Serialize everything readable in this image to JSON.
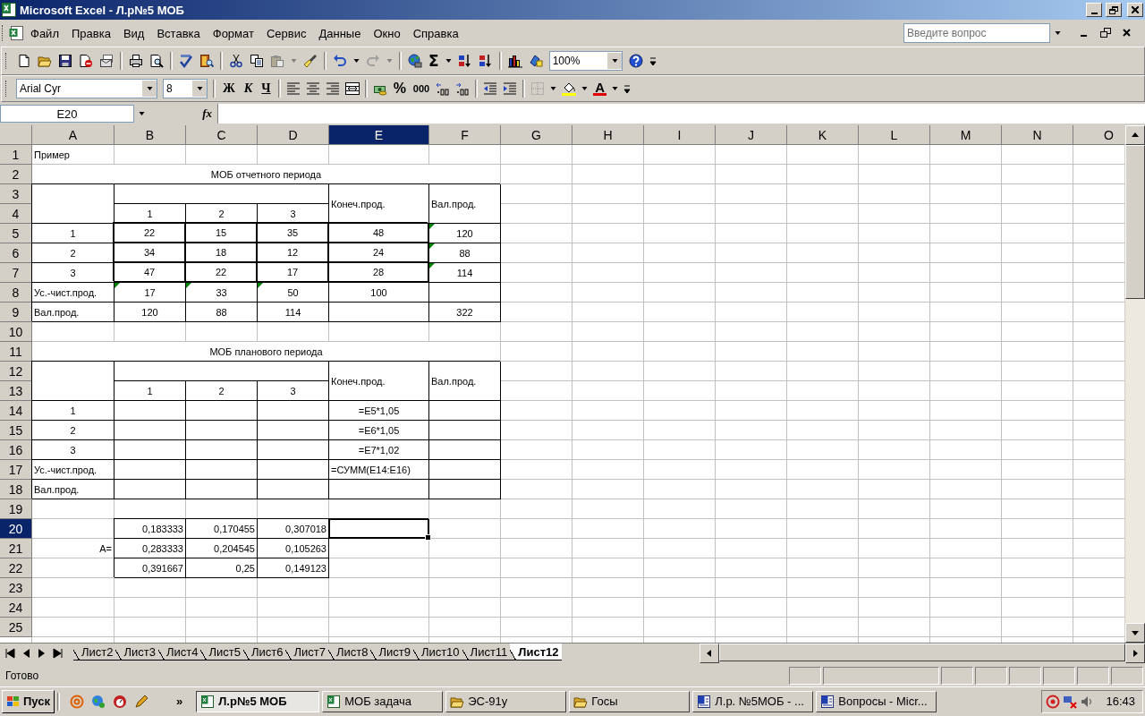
{
  "window": {
    "title": "Microsoft Excel - Л.р№5 МОБ"
  },
  "menu": [
    "Файл",
    "Правка",
    "Вид",
    "Вставка",
    "Формат",
    "Сервис",
    "Данные",
    "Окно",
    "Справка"
  ],
  "question_box": {
    "placeholder": "Введите вопрос"
  },
  "standard_toolbar": {
    "sum": "Σ",
    "zoom": "100%"
  },
  "formatting_toolbar": {
    "font": "Arial Cyr",
    "size": "8",
    "bold": "Ж",
    "italic": "К",
    "underline": "Ч",
    "percent": "%",
    "thousands": "000",
    "font_color": "A"
  },
  "formula_bar": {
    "name_box": "E20",
    "fx": "fx"
  },
  "columns": [
    {
      "label": "A",
      "selected": false
    },
    {
      "label": "B",
      "selected": false
    },
    {
      "label": "C",
      "selected": false
    },
    {
      "label": "D",
      "selected": false
    },
    {
      "label": "E",
      "selected": true
    },
    {
      "label": "F",
      "selected": false
    },
    {
      "label": "G",
      "selected": false
    },
    {
      "label": "H",
      "selected": false
    },
    {
      "label": "I",
      "selected": false
    },
    {
      "label": "J",
      "selected": false
    },
    {
      "label": "K",
      "selected": false
    },
    {
      "label": "L",
      "selected": false
    },
    {
      "label": "M",
      "selected": false
    },
    {
      "label": "N",
      "selected": false
    },
    {
      "label": "O",
      "selected": false
    }
  ],
  "rows": [
    {
      "label": "1",
      "selected": false,
      "cells": [
        {
          "text": "Пример",
          "kind": "note",
          "flag": false,
          "selected": false
        }
      ]
    },
    {
      "label": "2",
      "selected": false,
      "cells": [
        {
          "text": "МОБ отчетного периода",
          "kind": "title",
          "flag": false,
          "selected": false
        }
      ]
    },
    {
      "label": "3",
      "selected": false,
      "cells": [
        {
          "kind": "tall",
          "flag": false,
          "selected": false
        },
        {
          "kind": "band",
          "flag": false,
          "selected": false
        },
        {
          "text": "Конеч.прод.",
          "kind": "tall",
          "flag": false,
          "selected": false
        },
        {
          "text": "Вал.прод.",
          "kind": "tall",
          "flag": false,
          "selected": false
        }
      ]
    },
    {
      "label": "4",
      "selected": false,
      "cells": [
        {
          "text": "1",
          "kind": "number",
          "flag": false,
          "selected": false
        },
        {
          "text": "2",
          "kind": "number",
          "flag": false,
          "selected": false
        },
        {
          "text": "3",
          "kind": "number",
          "flag": false,
          "selected": false
        }
      ]
    },
    {
      "label": "5",
      "selected": false,
      "cells": [
        {
          "text": "1",
          "kind": "number",
          "flag": false,
          "selected": false
        },
        {
          "text": "22",
          "kind": "bold",
          "flag": false,
          "selected": false
        },
        {
          "text": "15",
          "kind": "bold",
          "flag": false,
          "selected": false
        },
        {
          "text": "35",
          "kind": "bold",
          "flag": false,
          "selected": false
        },
        {
          "text": "48",
          "kind": "bold",
          "flag": false,
          "selected": false
        },
        {
          "text": "120",
          "kind": "number",
          "flag": true,
          "selected": false
        }
      ]
    },
    {
      "label": "6",
      "selected": false,
      "cells": [
        {
          "text": "2",
          "kind": "number",
          "flag": false,
          "selected": false
        },
        {
          "text": "34",
          "kind": "bold",
          "flag": false,
          "selected": false
        },
        {
          "text": "18",
          "kind": "bold",
          "flag": false,
          "selected": false
        },
        {
          "text": "12",
          "kind": "bold",
          "flag": false,
          "selected": false
        },
        {
          "text": "24",
          "kind": "bold",
          "flag": false,
          "selected": false
        },
        {
          "text": "88",
          "kind": "number",
          "flag": true,
          "selected": false
        }
      ]
    },
    {
      "label": "7",
      "selected": false,
      "cells": [
        {
          "text": "3",
          "kind": "number",
          "flag": false,
          "selected": false
        },
        {
          "text": "47",
          "kind": "bold",
          "flag": false,
          "selected": false
        },
        {
          "text": "22",
          "kind": "bold",
          "flag": false,
          "selected": false
        },
        {
          "text": "17",
          "kind": "bold",
          "flag": false,
          "selected": false
        },
        {
          "text": "28",
          "kind": "bold",
          "flag": false,
          "selected": false
        },
        {
          "text": "114",
          "kind": "number",
          "flag": true,
          "selected": false
        }
      ]
    },
    {
      "label": "8",
      "selected": false,
      "cells": [
        {
          "text": "Ус.-чист.прод.",
          "kind": "label",
          "flag": false,
          "selected": false
        },
        {
          "text": "17",
          "kind": "number",
          "flag": true,
          "selected": false
        },
        {
          "text": "33",
          "kind": "number",
          "flag": true,
          "selected": false
        },
        {
          "text": "50",
          "kind": "number",
          "flag": true,
          "selected": false
        },
        {
          "text": "100",
          "kind": "number",
          "flag": false,
          "selected": false
        },
        {
          "kind": "number",
          "flag": false,
          "selected": false
        }
      ]
    },
    {
      "label": "9",
      "selected": false,
      "cells": [
        {
          "text": "Вал.прод.",
          "kind": "label",
          "flag": false,
          "selected": false
        },
        {
          "text": "120",
          "kind": "number",
          "flag": false,
          "selected": false
        },
        {
          "text": "88",
          "kind": "number",
          "flag": false,
          "selected": false
        },
        {
          "text": "114",
          "kind": "number",
          "flag": false,
          "selected": false
        },
        {
          "kind": "number",
          "flag": false,
          "selected": false
        },
        {
          "text": "322",
          "kind": "number",
          "flag": false,
          "selected": false
        }
      ]
    },
    {
      "label": "10",
      "selected": false
    },
    {
      "label": "11",
      "selected": false,
      "cells": [
        {
          "text": "МОБ планового периода",
          "kind": "title",
          "flag": false,
          "selected": false
        }
      ]
    },
    {
      "label": "12",
      "selected": false,
      "cells": [
        {
          "kind": "tall",
          "flag": false,
          "selected": false
        },
        {
          "kind": "band",
          "flag": false,
          "selected": false
        },
        {
          "text": "Конеч.прод.",
          "kind": "tall",
          "flag": false,
          "selected": false
        },
        {
          "text": "Вал.прод.",
          "kind": "tall",
          "flag": false,
          "selected": false
        }
      ]
    },
    {
      "label": "13",
      "selected": false,
      "cells": [
        {
          "text": "1",
          "kind": "number",
          "flag": false,
          "selected": false
        },
        {
          "text": "2",
          "kind": "number",
          "flag": false,
          "selected": false
        },
        {
          "text": "3",
          "kind": "number",
          "flag": false,
          "selected": false
        }
      ]
    },
    {
      "label": "14",
      "selected": false,
      "cells": [
        {
          "text": "1",
          "kind": "number",
          "flag": false,
          "selected": false
        },
        {
          "kind": "number",
          "flag": false,
          "selected": false
        },
        {
          "kind": "number",
          "flag": false,
          "selected": false
        },
        {
          "kind": "number",
          "flag": false,
          "selected": false
        },
        {
          "text": "=E5*1,05",
          "kind": "number",
          "flag": false,
          "selected": false
        },
        {
          "kind": "number",
          "flag": false,
          "selected": false
        }
      ]
    },
    {
      "label": "15",
      "selected": false,
      "cells": [
        {
          "text": "2",
          "kind": "number",
          "flag": false,
          "selected": false
        },
        {
          "kind": "number",
          "flag": false,
          "selected": false
        },
        {
          "kind": "number",
          "flag": false,
          "selected": false
        },
        {
          "kind": "number",
          "flag": false,
          "selected": false
        },
        {
          "text": "=E6*1,05",
          "kind": "number",
          "flag": false,
          "selected": false
        },
        {
          "kind": "number",
          "flag": false,
          "selected": false
        }
      ]
    },
    {
      "label": "16",
      "selected": false,
      "cells": [
        {
          "text": "3",
          "kind": "number",
          "flag": false,
          "selected": false
        },
        {
          "kind": "number",
          "flag": false,
          "selected": false
        },
        {
          "kind": "number",
          "flag": false,
          "selected": false
        },
        {
          "kind": "number",
          "flag": false,
          "selected": false
        },
        {
          "text": "=E7*1,02",
          "kind": "number",
          "flag": false,
          "selected": false
        },
        {
          "kind": "number",
          "flag": false,
          "selected": false
        }
      ]
    },
    {
      "label": "17",
      "selected": false,
      "cells": [
        {
          "text": "Ус.-чист.прод.",
          "kind": "label",
          "flag": false,
          "selected": false
        },
        {
          "kind": "number",
          "flag": false,
          "selected": false
        },
        {
          "kind": "number",
          "flag": false,
          "selected": false
        },
        {
          "kind": "number",
          "flag": false,
          "selected": false
        },
        {
          "text": "=СУММ(E14:E16)",
          "kind": "label",
          "flag": false,
          "selected": false
        },
        {
          "kind": "number",
          "flag": false,
          "selected": false
        }
      ]
    },
    {
      "label": "18",
      "selected": false,
      "cells": [
        {
          "text": "Вал.прод.",
          "kind": "label",
          "flag": false,
          "selected": false
        },
        {
          "kind": "number",
          "flag": false,
          "selected": false
        },
        {
          "kind": "number",
          "flag": false,
          "selected": false
        },
        {
          "kind": "number",
          "flag": false,
          "selected": false
        },
        {
          "kind": "number",
          "flag": false,
          "selected": false
        },
        {
          "kind": "number",
          "flag": false,
          "selected": false
        }
      ]
    },
    {
      "label": "19",
      "selected": false
    },
    {
      "label": "20",
      "selected": true,
      "cells": [
        {
          "kind": "blank",
          "flag": false,
          "selected": false
        },
        {
          "text": "0,183333",
          "kind": "decimal",
          "flag": false,
          "selected": false
        },
        {
          "text": "0,170455",
          "kind": "decimal",
          "flag": false,
          "selected": false
        },
        {
          "text": "0,307018",
          "kind": "decimal",
          "flag": false,
          "selected": false
        },
        {
          "kind": "blank",
          "flag": false,
          "selected": true
        }
      ]
    },
    {
      "label": "21",
      "selected": false,
      "cells": [
        {
          "text": "A=",
          "kind": "tag",
          "flag": false,
          "selected": false
        },
        {
          "text": "0,283333",
          "kind": "decimal",
          "flag": false,
          "selected": false
        },
        {
          "text": "0,204545",
          "kind": "decimal",
          "flag": false,
          "selected": false
        },
        {
          "text": "0,105263",
          "kind": "decimal",
          "flag": false,
          "selected": false
        }
      ]
    },
    {
      "label": "22",
      "selected": false,
      "cells": [
        {
          "kind": "blank",
          "flag": false,
          "selected": false
        },
        {
          "text": "0,391667",
          "kind": "decimal",
          "flag": false,
          "selected": false
        },
        {
          "text": "0,25",
          "kind": "decimal",
          "flag": false,
          "selected": false
        },
        {
          "text": "0,149123",
          "kind": "decimal",
          "flag": false,
          "selected": false
        }
      ]
    },
    {
      "label": "23",
      "selected": false
    },
    {
      "label": "24",
      "selected": false
    },
    {
      "label": "25",
      "selected": false
    }
  ],
  "sheet_tabs": [
    {
      "label": "Лист2",
      "selected": false
    },
    {
      "label": "Лист3",
      "selected": false
    },
    {
      "label": "Лист4",
      "selected": false
    },
    {
      "label": "Лист5",
      "selected": false
    },
    {
      "label": "Лист6",
      "selected": false
    },
    {
      "label": "Лист7",
      "selected": false
    },
    {
      "label": "Лист8",
      "selected": false
    },
    {
      "label": "Лист9",
      "selected": false
    },
    {
      "label": "Лист10",
      "selected": false
    },
    {
      "label": "Лист11",
      "selected": false
    },
    {
      "label": "Лист12",
      "selected": true
    }
  ],
  "status_bar": {
    "text": "Готово"
  },
  "taskbar": {
    "start": "Пуск",
    "more": "»",
    "tasks": [
      {
        "label": "Л.р№5 МОБ",
        "kind": "excel",
        "selected": true
      },
      {
        "label": "МОБ задача",
        "kind": "excel",
        "selected": false
      },
      {
        "label": "ЭС-91у",
        "kind": "folder",
        "selected": false
      },
      {
        "label": "Госы",
        "kind": "folder",
        "selected": false
      },
      {
        "label": "Л.р. №5МОБ - ...",
        "kind": "word",
        "selected": false
      },
      {
        "label": "Вопросы - Micr...",
        "kind": "word",
        "selected": false
      }
    ],
    "clock": "16:43"
  }
}
